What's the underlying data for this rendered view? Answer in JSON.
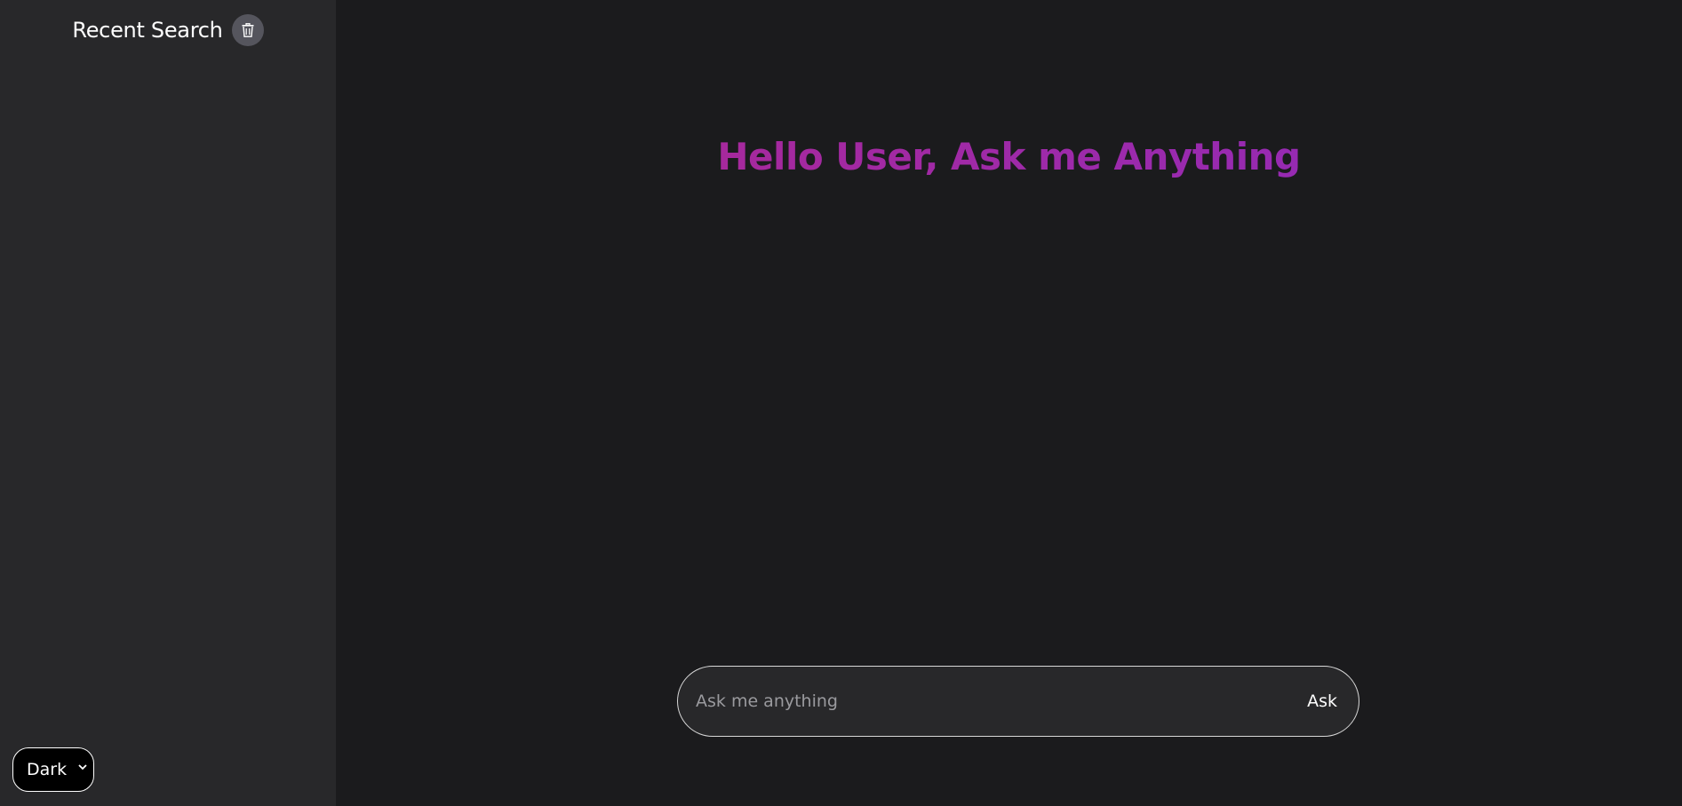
{
  "sidebar": {
    "title": "Recent Search",
    "clear_icon": "trash-icon",
    "recent_items": [],
    "theme_select": {
      "selected": "Dark",
      "icon": "chevron-down-icon"
    }
  },
  "main": {
    "greeting": "Hello User, Ask me Anything",
    "ask_input": {
      "value": "",
      "placeholder": "Ask me anything"
    },
    "ask_button_label": "Ask"
  },
  "colors": {
    "sidebar_bg": "#28282a",
    "main_bg": "#1b1b1d",
    "greeting_gradient_start": "#b0288f",
    "greeting_gradient_end": "#8d2bc0",
    "trash_button_bg": "#55555d"
  }
}
